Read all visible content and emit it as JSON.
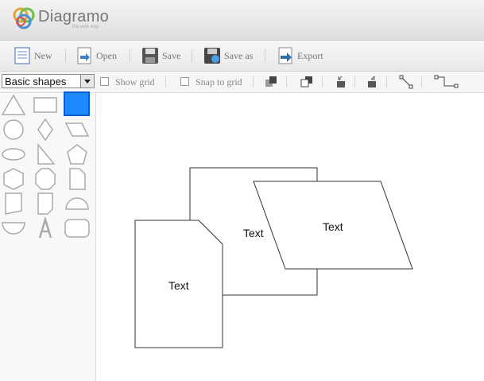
{
  "app": {
    "name": "Diagramo",
    "tagline": "the web way"
  },
  "toolbar": {
    "new_label": "New",
    "open_label": "Open",
    "save_label": "Save",
    "saveas_label": "Save as",
    "export_label": "Export"
  },
  "options": {
    "shape_set": "Basic shapes",
    "show_grid_label": "Show grid",
    "snap_label": "Snap to grid",
    "show_grid_checked": false,
    "snap_checked": false
  },
  "palette": {
    "shapes": [
      "triangle",
      "rectangle",
      "filled-square",
      "circle",
      "diamond",
      "parallelogram",
      "ellipse",
      "right-triangle",
      "pentagon",
      "hexagon",
      "octagon",
      "page",
      "document",
      "note",
      "semicircle-top",
      "semicircle-bottom",
      "text",
      "rounded-rectangle"
    ],
    "selected": "filled-square"
  },
  "canvas": {
    "shapes": [
      {
        "type": "rectangle",
        "text": "Text"
      },
      {
        "type": "parallelogram",
        "text": "Text"
      },
      {
        "type": "page",
        "text": "Text"
      }
    ]
  },
  "colors": {
    "selection": "#1e88ff",
    "stroke": "#333333",
    "icon_gray": "#777777"
  }
}
